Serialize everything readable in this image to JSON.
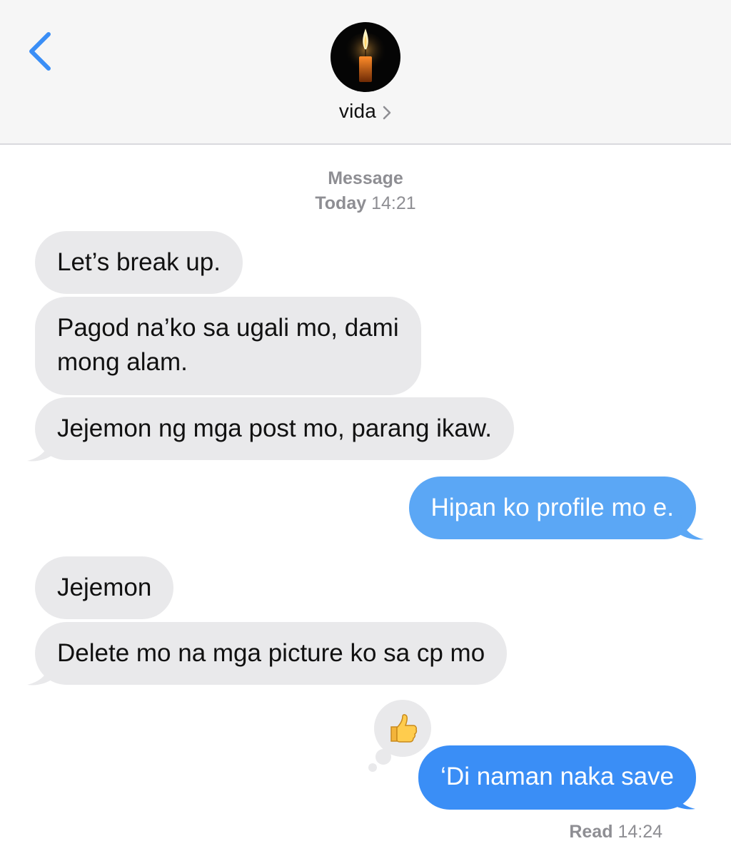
{
  "header": {
    "contact_name": "vida",
    "back_icon": "chevron-left-icon",
    "avatar_icon": "candle-icon",
    "name_chevron_icon": "chevron-right-icon",
    "accent_color": "#3a8ef6"
  },
  "thread": {
    "service_label": "Message",
    "day_label": "Today",
    "time_label": "14:21"
  },
  "messages": [
    {
      "direction": "received",
      "text": "Let’s break up."
    },
    {
      "direction": "received",
      "lines": [
        "Pagod na’ko sa ugali mo, dami",
        "mong alam."
      ]
    },
    {
      "direction": "received",
      "text": "Jejemon ng mga post mo, parang ikaw."
    },
    {
      "direction": "sent",
      "text": "Hipan ko profile mo e."
    },
    {
      "direction": "received",
      "text": "Jejemon"
    },
    {
      "direction": "received",
      "text": "Delete mo na mga picture ko sa cp mo"
    },
    {
      "direction": "sent",
      "text": "‘Di naman naka save",
      "tapback": "👍"
    }
  ],
  "receipt": {
    "status": "Read",
    "time": "14:24"
  },
  "colors": {
    "received_bubble": "#e9e9eb",
    "sent_bubble": "#3a8ef6",
    "sent_bubble_light": "#5ba7f5",
    "meta_text": "#8e8e93"
  }
}
